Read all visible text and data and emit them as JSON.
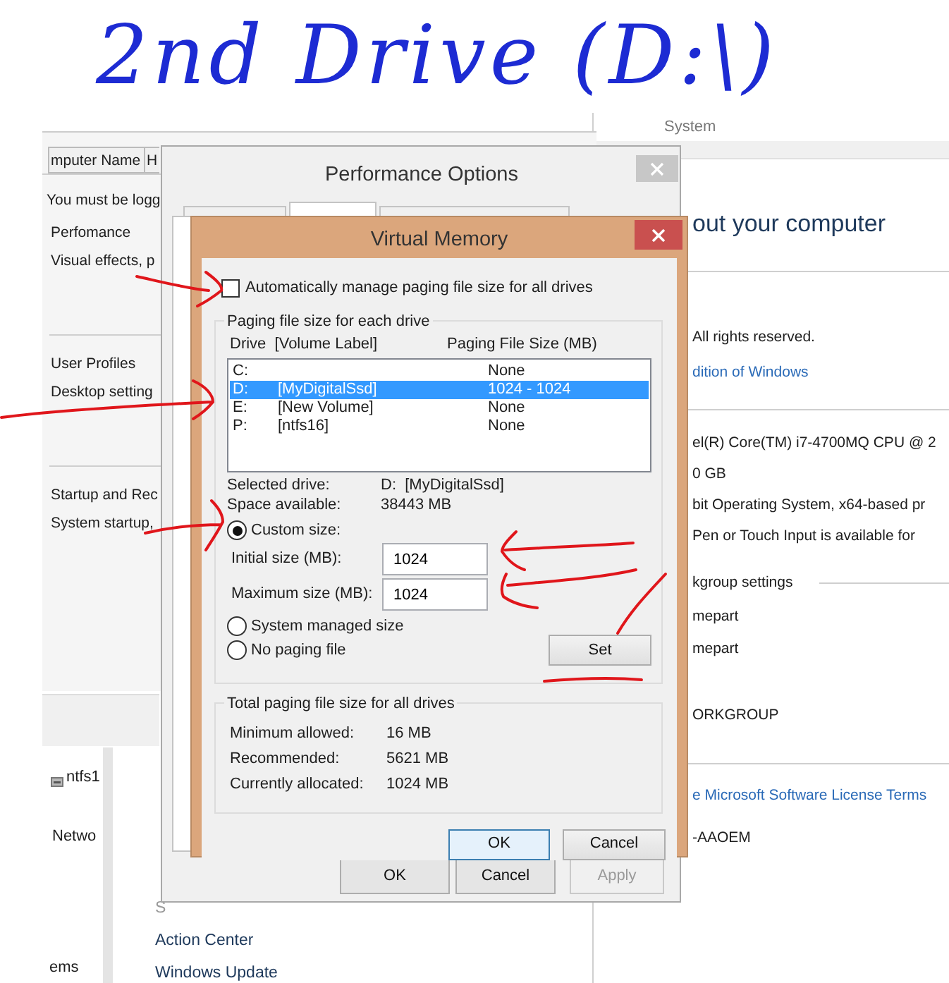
{
  "handwritten_note": "2nd Drive (D:\\)",
  "control_panel": {
    "breadcrumb": "System",
    "heading": "out your computer",
    "lines": [
      {
        "kind": "text",
        "text": "All rights reserved."
      },
      {
        "kind": "link",
        "text": "dition of Windows"
      },
      {
        "kind": "text",
        "text": "el(R) Core(TM) i7-4700MQ CPU @ 2"
      },
      {
        "kind": "text",
        "text": "0 GB"
      },
      {
        "kind": "text",
        "text": "bit Operating System, x64-based pr"
      },
      {
        "kind": "text",
        "text": "Pen or Touch Input is available for"
      },
      {
        "kind": "section",
        "text": "kgroup settings"
      },
      {
        "kind": "text",
        "text": "mepart"
      },
      {
        "kind": "text",
        "text": "mepart"
      },
      {
        "kind": "text",
        "text": "ORKGROUP"
      },
      {
        "kind": "link",
        "text": "e Microsoft Software License Terms"
      },
      {
        "kind": "text",
        "text": "-AAOEM"
      }
    ],
    "nav_items": [
      {
        "kind": "drive",
        "text": "ntfs1"
      },
      {
        "kind": "text",
        "text": "Netwo"
      },
      {
        "kind": "text",
        "text": "ems"
      }
    ],
    "see_also": {
      "heading": "S",
      "links": [
        "Action Center",
        "Windows Update"
      ]
    }
  },
  "system_properties": {
    "tabs": [
      {
        "label": "mputer Name",
        "selected": false
      },
      {
        "label": "H",
        "selected": false
      }
    ],
    "notice": "You must be logg",
    "groups": [
      {
        "title": "Perfomance",
        "text": "Visual effects, p"
      },
      {
        "title": "User Profiles",
        "text": "Desktop setting"
      },
      {
        "title": "Startup and Rec",
        "text": "System startup,"
      }
    ]
  },
  "performance_options": {
    "title": "Performance Options",
    "tabs": [
      {
        "selected": false
      },
      {
        "selected": true
      },
      {
        "selected": false
      }
    ],
    "buttons": [
      {
        "label": "OK",
        "disabled": false
      },
      {
        "label": "Cancel",
        "disabled": false
      },
      {
        "label": "Apply",
        "disabled": true
      }
    ]
  },
  "virtual_memory": {
    "title": "Virtual Memory",
    "auto_manage": {
      "label": "Automatically manage paging file size for all drives",
      "checked": false
    },
    "paging_group": {
      "title": "Paging file size for each drive",
      "column_1": "Drive  [Volume Label]",
      "column_2": "Paging File Size (MB)",
      "drives": [
        {
          "drive": "C:",
          "size": "None",
          "selected": false
        },
        {
          "drive": "D:",
          "label": "[MyDigitalSsd]",
          "size": "1024 - 1024",
          "selected": true
        },
        {
          "drive": "E:",
          "label": "[New Volume]",
          "size": "None",
          "selected": false
        },
        {
          "drive": "P:",
          "label": "[ntfs16]",
          "size": "None",
          "selected": false
        }
      ],
      "info": [
        {
          "label": "Selected drive:",
          "value": "D:  [MyDigitalSsd]"
        },
        {
          "label": "Space available:",
          "value": "38443 MB"
        }
      ],
      "size_options": [
        {
          "kind": "custom",
          "label": "Custom size:",
          "selected": true
        },
        {
          "kind": "system",
          "label": "System managed size",
          "selected": false
        },
        {
          "kind": "none",
          "label": "No paging file",
          "selected": false
        }
      ],
      "fields": [
        {
          "label": "Initial size (MB):",
          "value": "1024"
        },
        {
          "label": "Maximum size (MB):",
          "value": "1024"
        }
      ],
      "set_button": "Set"
    },
    "totals": {
      "title": "Total paging file size for all drives",
      "rows": [
        {
          "label": "Minimum allowed:",
          "value": "16 MB"
        },
        {
          "label": "Recommended:",
          "value": "5621 MB"
        },
        {
          "label": "Currently allocated:",
          "value": "1024 MB"
        }
      ]
    },
    "buttons": [
      {
        "label": "OK",
        "default": true
      },
      {
        "label": "Cancel",
        "default": false
      }
    ]
  }
}
